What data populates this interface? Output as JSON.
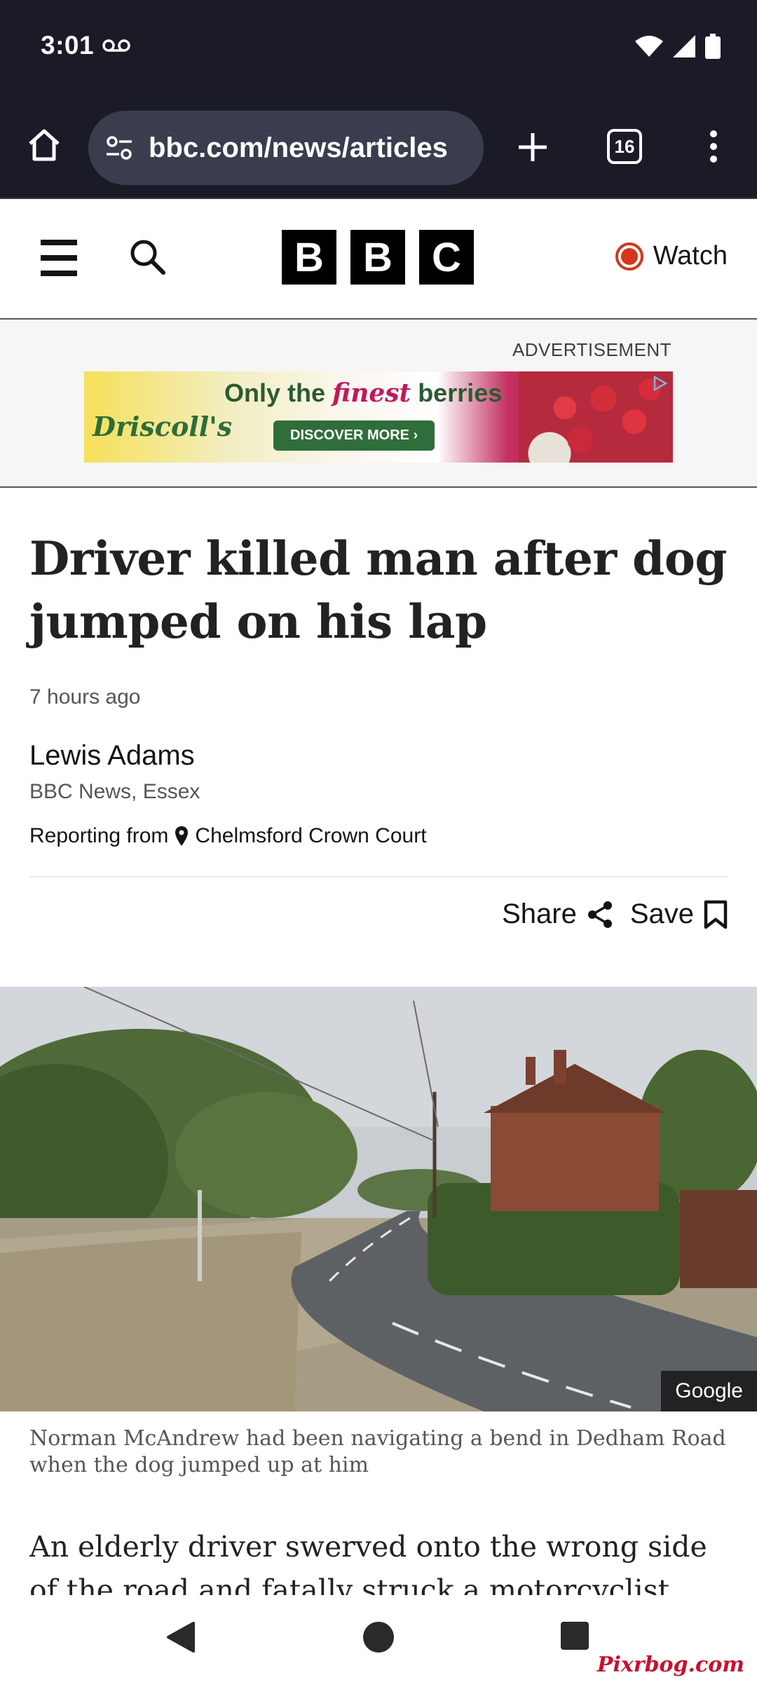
{
  "status_bar": {
    "time": "3:01"
  },
  "browser": {
    "url": "bbc.com/news/articles",
    "tab_count": "16"
  },
  "header": {
    "logo_letters": [
      "B",
      "B",
      "C"
    ],
    "watch_label": "Watch"
  },
  "ad": {
    "label": "ADVERTISEMENT",
    "brand": "Driscoll's",
    "tagline_pre": "Only the ",
    "tagline_em": "finest",
    "tagline_post": " berries",
    "cta": "DISCOVER MORE ›"
  },
  "article": {
    "headline": "Driver killed man after dog jumped on his lap",
    "time_ago": "7 hours ago",
    "author": "Lewis Adams",
    "org": "BBC News, Essex",
    "reporting_label": "Reporting from",
    "location": "Chelmsford Crown Court",
    "share_label": "Share",
    "save_label": "Save",
    "image_credit": "Google",
    "caption": "Norman McAndrew had been navigating a bend in Dedham Road when the dog jumped up at him",
    "body": "An elderly driver swerved onto the wrong side of the road and fatally struck a motorcyclist after an"
  },
  "watermark": "Pixrbog.com",
  "colors": {
    "bbc_red": "#d4351c",
    "browser_bg": "#1b1b28",
    "url_bg": "#3a3d4e"
  },
  "icons": [
    "voicemail-icon",
    "wifi-icon",
    "signal-icon",
    "battery-icon",
    "home-icon",
    "site-settings-icon",
    "new-tab-icon",
    "tabs-icon",
    "more-menu-icon",
    "menu-icon",
    "search-icon",
    "live-dot-icon",
    "location-pin-icon",
    "share-icon",
    "bookmark-icon",
    "nav-back-icon",
    "nav-home-icon",
    "nav-recents-icon"
  ]
}
